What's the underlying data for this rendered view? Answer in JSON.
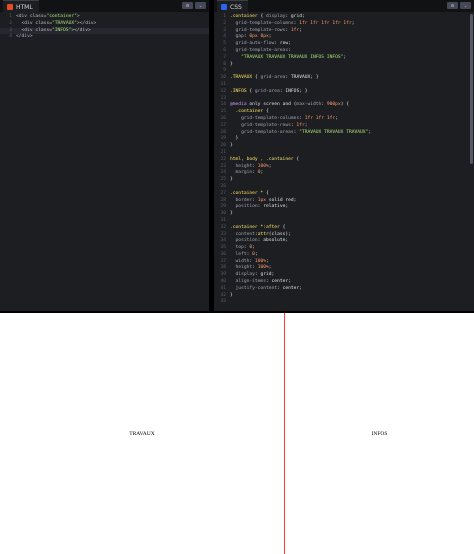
{
  "html_panel": {
    "tab_label": "HTML",
    "icon_color": "#e34c26",
    "buttons": [
      "⚙",
      "⌄"
    ],
    "lines": [
      [
        {
          "t": "<div ",
          "c": "tag"
        },
        {
          "t": "class=",
          "c": "attr"
        },
        {
          "t": "\"container\"",
          "c": "str"
        },
        {
          "t": ">",
          "c": "tag"
        }
      ],
      [
        {
          "t": "  <div ",
          "c": "tag"
        },
        {
          "t": "class=",
          "c": "attr"
        },
        {
          "t": "\"TRAVAUX\"",
          "c": "str"
        },
        {
          "t": "></div>",
          "c": "tag"
        }
      ],
      [
        {
          "t": "  <div ",
          "c": "tag"
        },
        {
          "t": "class=",
          "c": "attr"
        },
        {
          "t": "\"INFOS\"",
          "c": "str"
        },
        {
          "t": "></div>",
          "c": "tag"
        }
      ],
      [
        {
          "t": "</div>",
          "c": "tag"
        }
      ]
    ]
  },
  "css_panel": {
    "tab_label": "CSS",
    "icon_color": "#2965f1",
    "buttons": [
      "⚙",
      "⌄"
    ],
    "lines": [
      [
        {
          "t": ".container ",
          "c": "sel"
        },
        {
          "t": "{ ",
          "c": "plain"
        },
        {
          "t": "display",
          "c": "prop"
        },
        {
          "t": ": ",
          "c": "plain"
        },
        {
          "t": "grid",
          "c": "plain"
        },
        {
          "t": ";",
          "c": "plain"
        }
      ],
      [
        {
          "t": "  grid-template-columns",
          "c": "prop"
        },
        {
          "t": ": ",
          "c": "plain"
        },
        {
          "t": "1fr 1fr 1fr 1fr 1fr",
          "c": "num"
        },
        {
          "t": ";",
          "c": "plain"
        }
      ],
      [
        {
          "t": "  grid-template-rows",
          "c": "prop"
        },
        {
          "t": ": ",
          "c": "plain"
        },
        {
          "t": "1fr",
          "c": "num"
        },
        {
          "t": ";",
          "c": "plain"
        }
      ],
      [
        {
          "t": "  gap",
          "c": "prop"
        },
        {
          "t": ": ",
          "c": "plain"
        },
        {
          "t": "0px 0px",
          "c": "num"
        },
        {
          "t": ";",
          "c": "plain"
        }
      ],
      [
        {
          "t": "  grid-auto-flow",
          "c": "prop"
        },
        {
          "t": ": ",
          "c": "plain"
        },
        {
          "t": "row",
          "c": "plain"
        },
        {
          "t": ";",
          "c": "plain"
        }
      ],
      [
        {
          "t": "  grid-template-areas",
          "c": "prop"
        },
        {
          "t": ":",
          "c": "plain"
        }
      ],
      [
        {
          "t": "    \"TRAVAUX TRAVAUX TRAVAUX INFOS INFOS\"",
          "c": "str"
        },
        {
          "t": ";",
          "c": "plain"
        }
      ],
      [
        {
          "t": "}",
          "c": "plain"
        }
      ],
      [],
      [
        {
          "t": ".TRAVAUX ",
          "c": "sel"
        },
        {
          "t": "{ ",
          "c": "plain"
        },
        {
          "t": "grid-area",
          "c": "prop"
        },
        {
          "t": ": ",
          "c": "plain"
        },
        {
          "t": "TRAVAUX",
          "c": "plain"
        },
        {
          "t": "; }",
          "c": "plain"
        }
      ],
      [],
      [
        {
          "t": ".INFOS ",
          "c": "sel"
        },
        {
          "t": "{ ",
          "c": "plain"
        },
        {
          "t": "grid-area",
          "c": "prop"
        },
        {
          "t": ": ",
          "c": "plain"
        },
        {
          "t": "INFOS",
          "c": "plain"
        },
        {
          "t": "; }",
          "c": "plain"
        }
      ],
      [],
      [
        {
          "t": "@media ",
          "c": "kw"
        },
        {
          "t": "only screen and ",
          "c": "plain"
        },
        {
          "t": "(",
          "c": "plain"
        },
        {
          "t": "max-width",
          "c": "prop"
        },
        {
          "t": ": ",
          "c": "plain"
        },
        {
          "t": "900px",
          "c": "num"
        },
        {
          "t": ") {",
          "c": "plain"
        }
      ],
      [
        {
          "t": "  .container ",
          "c": "sel"
        },
        {
          "t": "{",
          "c": "plain"
        }
      ],
      [
        {
          "t": "    grid-template-columns",
          "c": "prop"
        },
        {
          "t": ": ",
          "c": "plain"
        },
        {
          "t": "1fr 1fr 1fr",
          "c": "num"
        },
        {
          "t": ";",
          "c": "plain"
        }
      ],
      [
        {
          "t": "    grid-template-rows",
          "c": "prop"
        },
        {
          "t": ": ",
          "c": "plain"
        },
        {
          "t": "1fr",
          "c": "num"
        },
        {
          "t": ";",
          "c": "plain"
        }
      ],
      [
        {
          "t": "    grid-template-areas",
          "c": "prop"
        },
        {
          "t": ": ",
          "c": "plain"
        },
        {
          "t": "\"TRAVAUX TRAVAUX TRAVAUX\"",
          "c": "str"
        },
        {
          "t": ";",
          "c": "plain"
        }
      ],
      [
        {
          "t": "  }",
          "c": "plain"
        }
      ],
      [
        {
          "t": "}",
          "c": "plain"
        }
      ],
      [],
      [
        {
          "t": "html, body , .container ",
          "c": "sel"
        },
        {
          "t": "{",
          "c": "plain"
        }
      ],
      [
        {
          "t": "  height",
          "c": "prop"
        },
        {
          "t": ": ",
          "c": "plain"
        },
        {
          "t": "100%",
          "c": "num"
        },
        {
          "t": ";",
          "c": "plain"
        }
      ],
      [
        {
          "t": "  margin",
          "c": "prop"
        },
        {
          "t": ": ",
          "c": "plain"
        },
        {
          "t": "0",
          "c": "num"
        },
        {
          "t": ";",
          "c": "plain"
        }
      ],
      [
        {
          "t": "}",
          "c": "plain"
        }
      ],
      [],
      [
        {
          "t": ".container * ",
          "c": "sel"
        },
        {
          "t": "{",
          "c": "plain"
        }
      ],
      [
        {
          "t": "  border",
          "c": "prop"
        },
        {
          "t": ": ",
          "c": "plain"
        },
        {
          "t": "1px ",
          "c": "num"
        },
        {
          "t": "solid red",
          "c": "plain"
        },
        {
          "t": ";",
          "c": "plain"
        }
      ],
      [
        {
          "t": "  position",
          "c": "prop"
        },
        {
          "t": ": ",
          "c": "plain"
        },
        {
          "t": "relative",
          "c": "plain"
        },
        {
          "t": ";",
          "c": "plain"
        }
      ],
      [
        {
          "t": "}",
          "c": "plain"
        }
      ],
      [],
      [
        {
          "t": ".container *:after ",
          "c": "sel"
        },
        {
          "t": "{",
          "c": "plain"
        }
      ],
      [
        {
          "t": "  content",
          "c": "prop"
        },
        {
          "t": ":",
          "c": "plain"
        },
        {
          "t": "attr",
          "c": "sel"
        },
        {
          "t": "(class);",
          "c": "plain"
        }
      ],
      [
        {
          "t": "  position",
          "c": "prop"
        },
        {
          "t": ": ",
          "c": "plain"
        },
        {
          "t": "absolute",
          "c": "plain"
        },
        {
          "t": ";",
          "c": "plain"
        }
      ],
      [
        {
          "t": "  top",
          "c": "prop"
        },
        {
          "t": ": ",
          "c": "plain"
        },
        {
          "t": "0",
          "c": "num"
        },
        {
          "t": ";",
          "c": "plain"
        }
      ],
      [
        {
          "t": "  left",
          "c": "prop"
        },
        {
          "t": ": ",
          "c": "plain"
        },
        {
          "t": "0",
          "c": "num"
        },
        {
          "t": ";",
          "c": "plain"
        }
      ],
      [
        {
          "t": "  width",
          "c": "prop"
        },
        {
          "t": ": ",
          "c": "plain"
        },
        {
          "t": "100%",
          "c": "num"
        },
        {
          "t": ";",
          "c": "plain"
        }
      ],
      [
        {
          "t": "  height",
          "c": "prop"
        },
        {
          "t": ": ",
          "c": "plain"
        },
        {
          "t": "100%",
          "c": "num"
        },
        {
          "t": ";",
          "c": "plain"
        }
      ],
      [
        {
          "t": "  display",
          "c": "prop"
        },
        {
          "t": ": ",
          "c": "plain"
        },
        {
          "t": "grid",
          "c": "plain"
        },
        {
          "t": ";",
          "c": "plain"
        }
      ],
      [
        {
          "t": "  align-items",
          "c": "prop"
        },
        {
          "t": ": ",
          "c": "plain"
        },
        {
          "t": "center",
          "c": "plain"
        },
        {
          "t": ";",
          "c": "plain"
        }
      ],
      [
        {
          "t": "  justify-content",
          "c": "prop"
        },
        {
          "t": ": ",
          "c": "plain"
        },
        {
          "t": "center",
          "c": "plain"
        },
        {
          "t": ";",
          "c": "plain"
        }
      ],
      [
        {
          "t": "}",
          "c": "plain"
        }
      ],
      []
    ]
  },
  "preview": {
    "travaux_label": "TRAVAUX",
    "infos_label": "INFOS",
    "border_color": "#ff3b3b"
  }
}
